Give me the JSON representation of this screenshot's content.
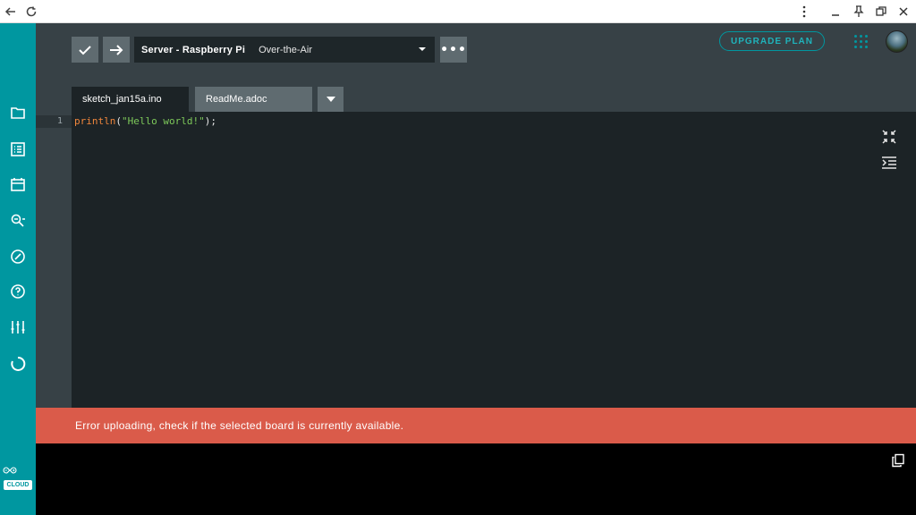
{
  "browser": {
    "back_icon": "back-arrow-icon",
    "reload_icon": "reload-icon",
    "menu_icon": "kebab-menu-icon",
    "minimize_icon": "minimize-icon",
    "pin_icon": "pin-icon",
    "restore_icon": "restore-icon",
    "close_icon": "close-icon"
  },
  "sidebar": {
    "items": [
      {
        "name": "sketchbook",
        "icon": "folder-icon"
      },
      {
        "name": "examples",
        "icon": "list-icon"
      },
      {
        "name": "libraries",
        "icon": "library-icon"
      },
      {
        "name": "serial-monitor",
        "icon": "monitor-search-icon"
      },
      {
        "name": "reference",
        "icon": "compass-icon"
      },
      {
        "name": "help",
        "icon": "help-icon"
      },
      {
        "name": "preferences",
        "icon": "sliders-icon"
      },
      {
        "name": "features",
        "icon": "circle-progress-icon"
      }
    ],
    "logo": {
      "text": "CLOUD",
      "icon": "arduino-infinity-logo"
    }
  },
  "toolbar": {
    "verify_icon": "checkmark-icon",
    "upload_icon": "arrow-right-icon",
    "board": "Server - Raspberry Pi",
    "port": "Over-the-Air",
    "more_label": "•••"
  },
  "header": {
    "upgrade_label": "UPGRADE PLAN",
    "apps_icon": "apps-grid-icon",
    "avatar_icon": "user-avatar"
  },
  "tabs": [
    {
      "label": "sketch_jan15a.ino",
      "active": true
    },
    {
      "label": "ReadMe.adoc",
      "active": false
    }
  ],
  "editor": {
    "line_number": "1",
    "code": {
      "fn": "println",
      "open": "(",
      "str": "\"Hello world!\"",
      "close": ");"
    }
  },
  "error": {
    "message": "Error uploading, check if the selected board is currently available."
  },
  "colors": {
    "accent": "#0097a0",
    "error": "#da5b4a",
    "editor_bg": "#1c2326"
  }
}
